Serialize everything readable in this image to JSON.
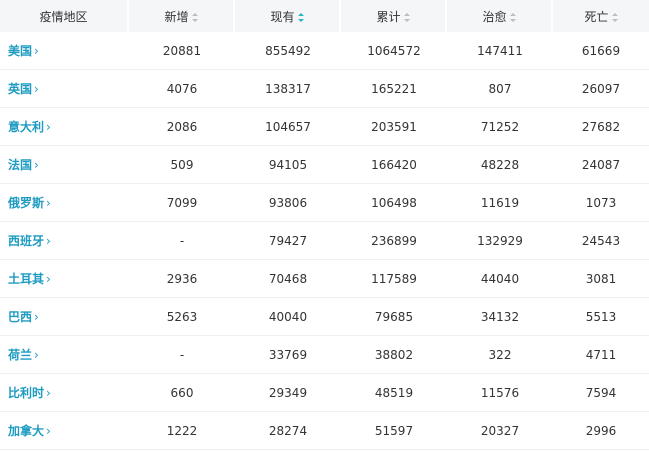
{
  "table": {
    "headers": [
      {
        "label": "疫情地区",
        "sortable": false,
        "active": false
      },
      {
        "label": "新增",
        "sortable": true,
        "active": false
      },
      {
        "label": "现有",
        "sortable": true,
        "active": true
      },
      {
        "label": "累计",
        "sortable": true,
        "active": false
      },
      {
        "label": "治愈",
        "sortable": true,
        "active": false
      },
      {
        "label": "死亡",
        "sortable": true,
        "active": false
      }
    ],
    "rows": [
      {
        "region": "美国",
        "new": "20881",
        "current": "855492",
        "total": "1064572",
        "cured": "147411",
        "deaths": "61669"
      },
      {
        "region": "英国",
        "new": "4076",
        "current": "138317",
        "total": "165221",
        "cured": "807",
        "deaths": "26097"
      },
      {
        "region": "意大利",
        "new": "2086",
        "current": "104657",
        "total": "203591",
        "cured": "71252",
        "deaths": "27682"
      },
      {
        "region": "法国",
        "new": "509",
        "current": "94105",
        "total": "166420",
        "cured": "48228",
        "deaths": "24087"
      },
      {
        "region": "俄罗斯",
        "new": "7099",
        "current": "93806",
        "total": "106498",
        "cured": "11619",
        "deaths": "1073"
      },
      {
        "region": "西班牙",
        "new": "-",
        "current": "79427",
        "total": "236899",
        "cured": "132929",
        "deaths": "24543"
      },
      {
        "region": "土耳其",
        "new": "2936",
        "current": "70468",
        "total": "117589",
        "cured": "44040",
        "deaths": "3081"
      },
      {
        "region": "巴西",
        "new": "5263",
        "current": "40040",
        "total": "79685",
        "cured": "34132",
        "deaths": "5513"
      },
      {
        "region": "荷兰",
        "new": "-",
        "current": "33769",
        "total": "38802",
        "cured": "322",
        "deaths": "4711"
      },
      {
        "region": "比利时",
        "new": "660",
        "current": "29349",
        "total": "48519",
        "cured": "11576",
        "deaths": "7594"
      },
      {
        "region": "加拿大",
        "new": "1222",
        "current": "28274",
        "total": "51597",
        "cured": "20327",
        "deaths": "2996"
      }
    ]
  },
  "icons": {
    "row_link": "chevron-right-icon",
    "sort": "sort-icon"
  },
  "colors": {
    "link": "#1d9bc2",
    "active_sort": "#24b8c5",
    "header_bg": "#f5f6f8"
  }
}
